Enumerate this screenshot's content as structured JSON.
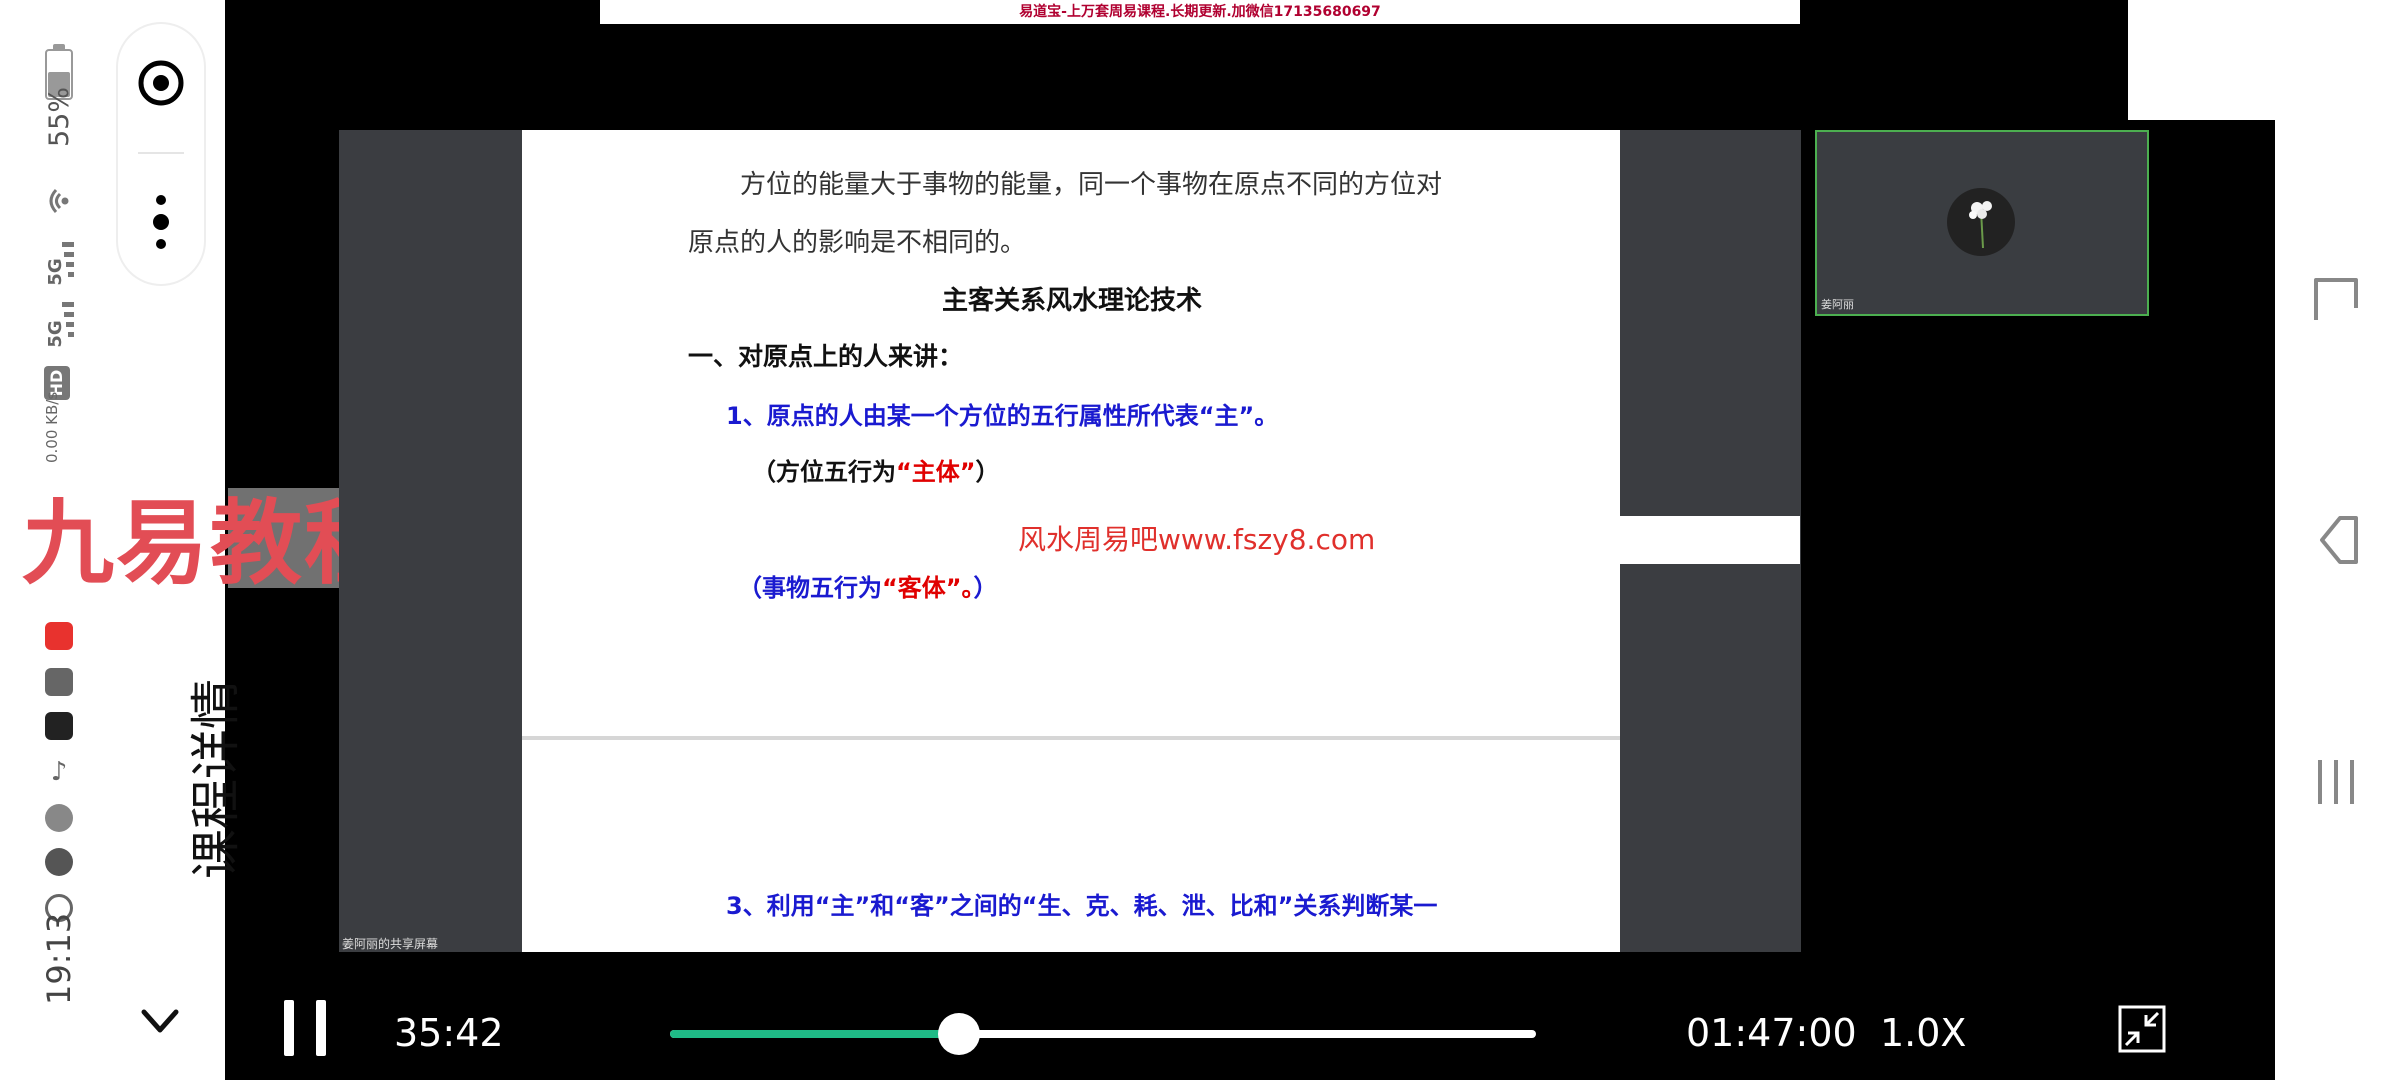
{
  "status_bar": {
    "time": "19:13",
    "battery_percent": "55%",
    "net_speed": "0.00 KB/s",
    "network_1": "5G",
    "network_2": "5G",
    "hd_label": "HD"
  },
  "left_panel": {
    "course_detail": "课程详情",
    "watermark_logo": "九易教程"
  },
  "top_banner": "易道宝-上万套周易课程.长期更新.加微信17135680697",
  "slide": {
    "para_line1": "方位的能量大于事物的能量，同一个事物在原点不同的方位对",
    "para_line2": "原点的人的影响是不相同的。",
    "heading": "主客关系风水理论技术",
    "section1": "一、对原点上的人来讲：",
    "item1": "1、原点的人由某一个方位的五行属性所代表“主”。",
    "note1_pre": "（方位五行为",
    "note1_em": "“主体”",
    "note1_post": "）",
    "note2_pre": "（事物五行为",
    "note2_em": "“客体”。",
    "note2_post": "）",
    "item3": "3、利用“主”和“客”之间的“生、克、耗、泄、比和”关系判断某一"
  },
  "video_watermark": "风水周易吧www.fszy8.com",
  "share_label": "姜阿丽的共享屏幕",
  "participant_name": "姜阿丽",
  "player": {
    "current_time": "35:42",
    "total_time": "01:47:00",
    "speed": "1.0X",
    "progress": 0.334
  },
  "colors": {
    "progress": "#1fba86",
    "slide_blue": "#1a1ad0",
    "slide_red": "#e00000",
    "logo_red": "#e24d55"
  }
}
